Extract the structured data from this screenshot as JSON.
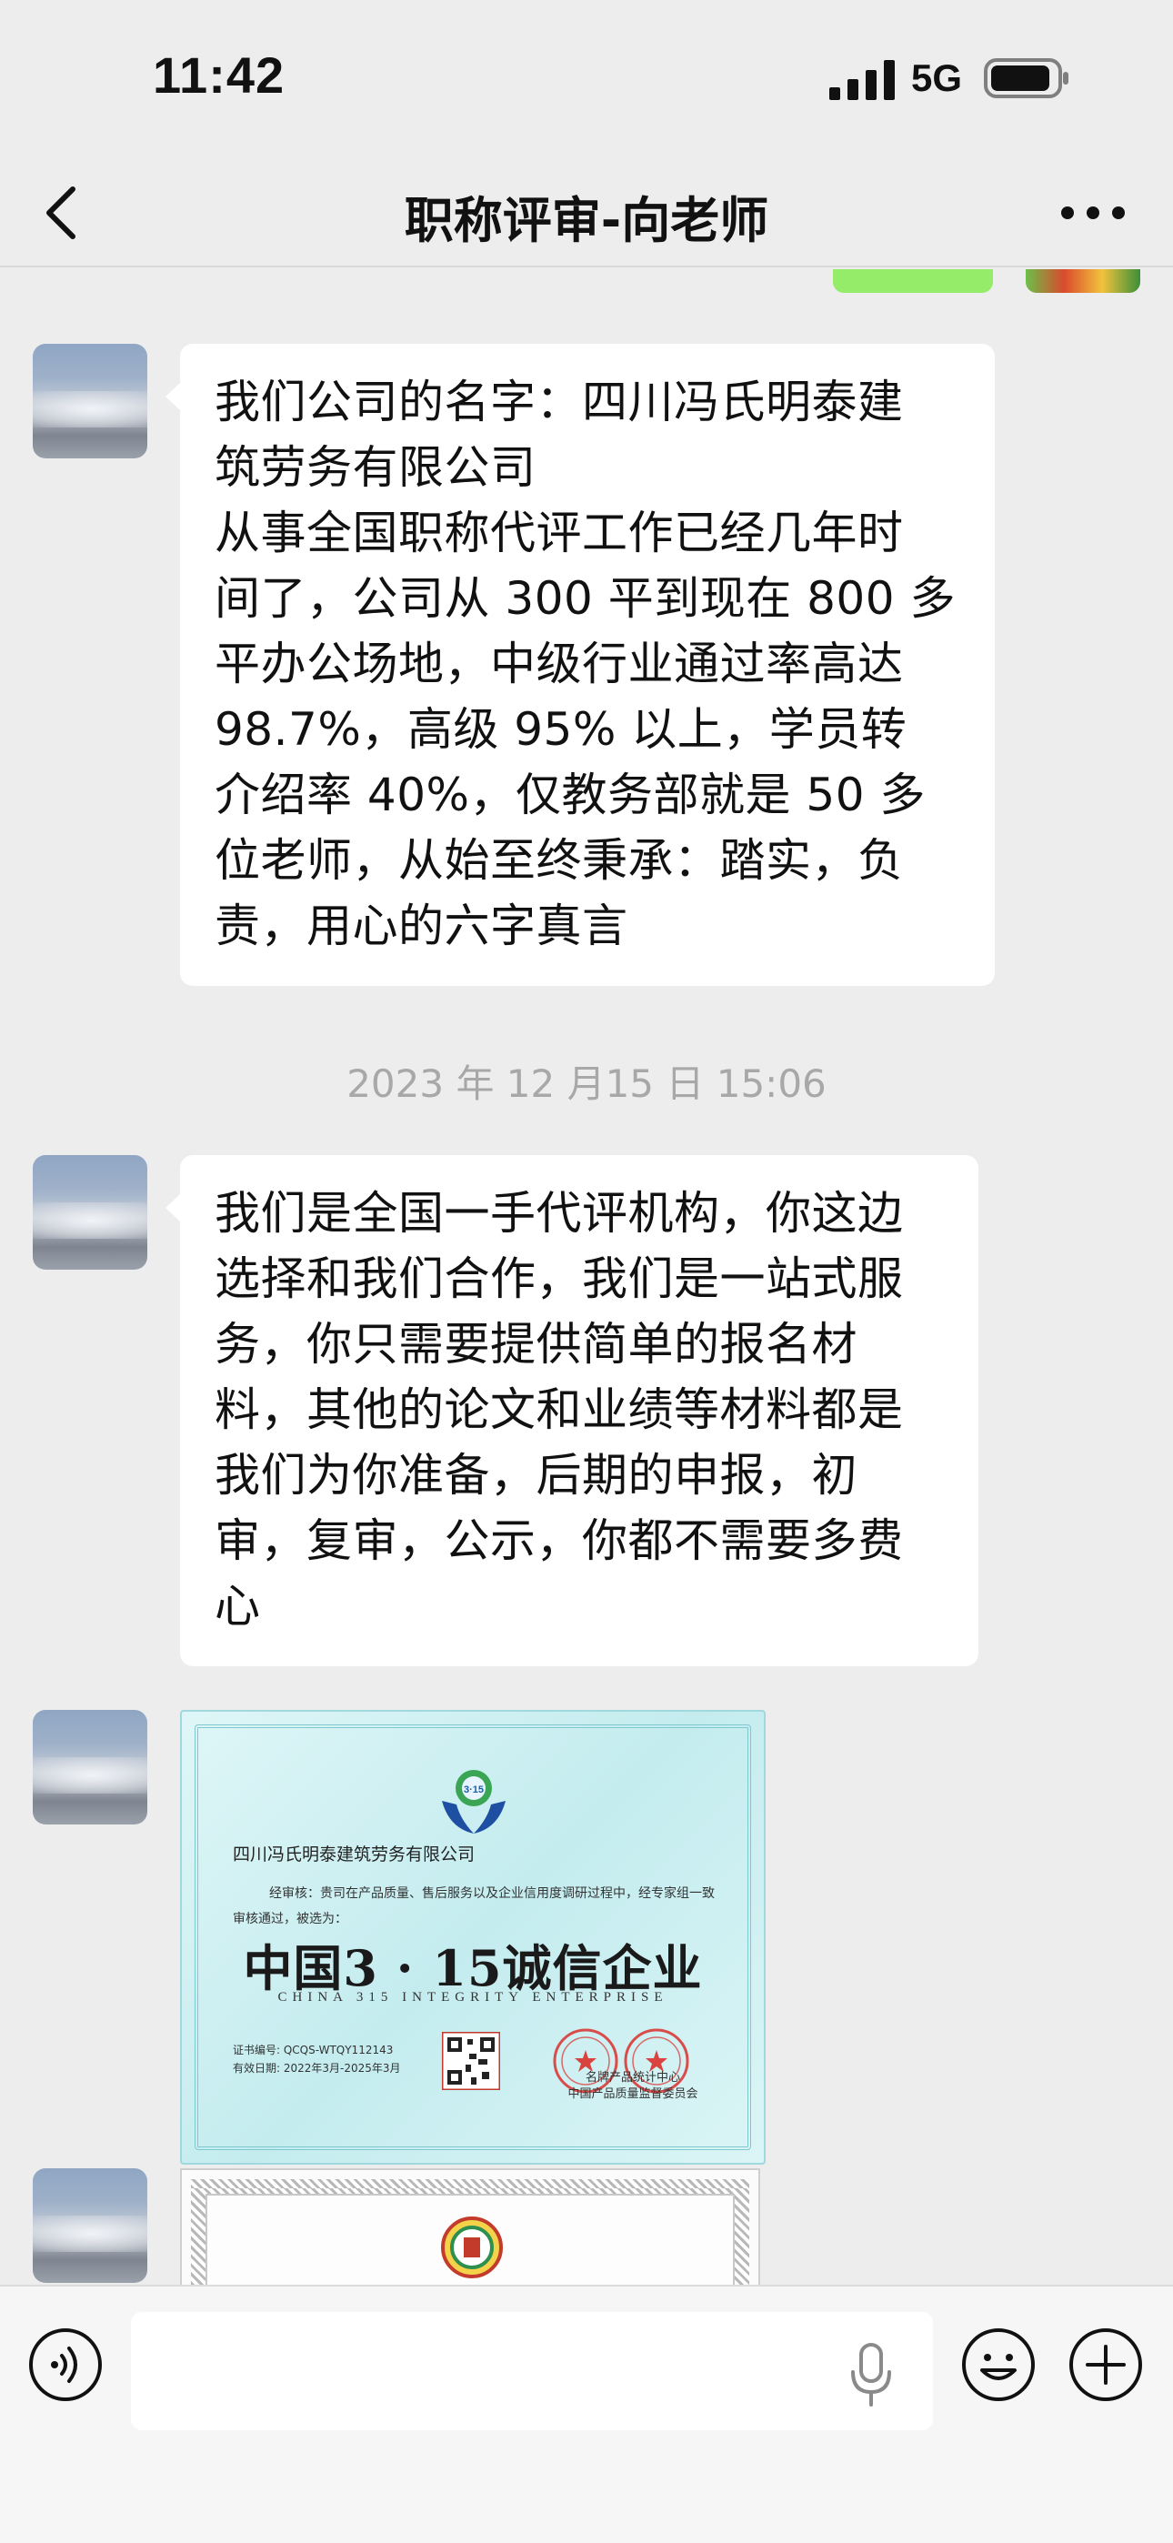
{
  "status_bar": {
    "time": "11:42",
    "network": "5G"
  },
  "nav": {
    "title": "职称评审-向老师"
  },
  "messages": [
    {
      "lines": [
        "我们公司的名字：四川冯氏明泰建",
        "筑劳务有限公司",
        "从事全国职称代评工作已经几年时",
        "间了，公司从 300 平到现在 800 多",
        "平办公场地，中级行业通过率高达",
        "98.7%，高级 95% 以上，学员转",
        "介绍率 40%，仅教务部就是 50 多",
        "位老师，从始至终秉承：踏实，负",
        "责，用心的六字真言"
      ]
    },
    {
      "lines": [
        "我们是全国一手代评机构，你这边",
        "选择和我们合作，我们是一站式服",
        "务，你只需要提供简单的报名材",
        "料，其他的论文和业绩等材料都是",
        "我们为你准备，后期的申报，初",
        "审，复审，公示，你都不需要多费",
        "心"
      ]
    }
  ],
  "timestamp": "2023 年 12 月15 日 15:06",
  "certificate": {
    "logo_text": "3·15",
    "company": "四川冯氏明泰建筑劳务有限公司",
    "body": "经审核：贵司在产品质量、售后服务以及企业信用度调研过程中，经专家组一致审核通过，被选为：",
    "title": "中国3 · 15诚信企业",
    "subtitle": "CHINA 315 INTEGRITY ENTERPRISE",
    "cert_no": "证书编号: QCQS-WTQY112143",
    "valid": "有效日期: 2022年3月-2025年3月",
    "issuer_line1": "名牌产品统计中心",
    "issuer_line2": "中国产品质量监督委员会"
  },
  "input": {
    "placeholder": ""
  },
  "colors": {
    "background": "#ededed",
    "bubble": "#ffffff",
    "self_bubble": "#95ec69",
    "timestamp": "#a8a8a8"
  },
  "icons": {
    "back": "chevron-left-icon",
    "more": "more-dots-icon",
    "voice": "voice-icon",
    "mic": "microphone-icon",
    "emoji": "emoji-icon",
    "plus": "plus-icon"
  }
}
